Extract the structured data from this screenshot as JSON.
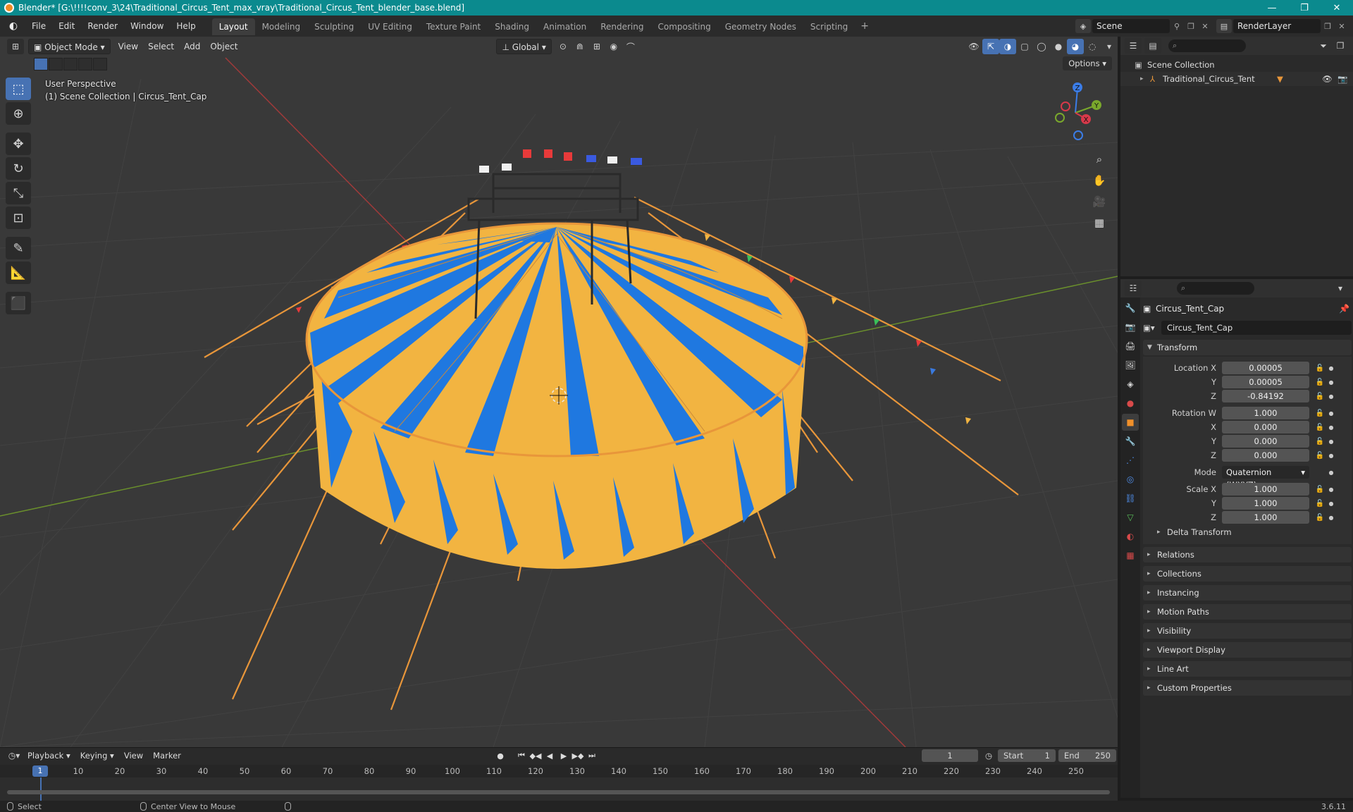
{
  "window": {
    "title": "Blender* [G:\\!!!!conv_3\\24\\Traditional_Circus_Tent_max_vray\\Traditional_Circus_Tent_blender_base.blend]",
    "minimize": "—",
    "maximize": "❐",
    "close": "✕"
  },
  "menu": [
    "File",
    "Edit",
    "Render",
    "Window",
    "Help"
  ],
  "workspaces": [
    "Layout",
    "Modeling",
    "Sculpting",
    "UV Editing",
    "Texture Paint",
    "Shading",
    "Animation",
    "Rendering",
    "Compositing",
    "Geometry Nodes",
    "Scripting"
  ],
  "active_workspace": "Layout",
  "scene": {
    "name": "Scene",
    "view_layer": "RenderLayer"
  },
  "viewport": {
    "mode": "Object Mode",
    "menus": [
      "View",
      "Select",
      "Add",
      "Object"
    ],
    "transform_orientation": "Global",
    "options_label": "Options",
    "perspective_label": "User Perspective",
    "collection_label": "(1) Scene Collection | Circus_Tent_Cap",
    "gizmo_axes": {
      "x": "X",
      "y": "Y",
      "z": "Z"
    },
    "colors": {
      "tent_blue": "#1f78e0",
      "tent_yellow": "#f2b441",
      "rope_orange": "#e8963a",
      "grid": "#474747"
    }
  },
  "outliner": {
    "search_placeholder": "",
    "root": "Scene Collection",
    "items": [
      {
        "name": "Traditional_Circus_Tent"
      }
    ]
  },
  "properties": {
    "object_name": "Circus_Tent_Cap",
    "datablock_name": "Circus_Tent_Cap",
    "transform": {
      "title": "Transform",
      "location_label": "Location X",
      "location": {
        "x": "0.00005",
        "y": "0.00005",
        "z": "-0.84192"
      },
      "rotation_label": "Rotation W",
      "rotation": {
        "w": "1.000",
        "x": "0.000",
        "y": "0.000",
        "z": "0.000"
      },
      "mode_label": "Mode",
      "mode_value": "Quaternion (WXYZ)",
      "scale_label": "Scale X",
      "scale": {
        "x": "1.000",
        "y": "1.000",
        "z": "1.000"
      },
      "axis_y": "Y",
      "axis_z": "Z",
      "axis_x": "X",
      "delta": "Delta Transform"
    },
    "collapsed_panels": [
      "Relations",
      "Collections",
      "Instancing",
      "Motion Paths",
      "Visibility",
      "Viewport Display",
      "Line Art",
      "Custom Properties"
    ]
  },
  "timeline": {
    "menus": [
      "Playback",
      "Keying",
      "View",
      "Marker"
    ],
    "current_frame": "1",
    "start_label": "Start",
    "start": "1",
    "end_label": "End",
    "end": "250",
    "ruler": [
      "10",
      "20",
      "30",
      "40",
      "50",
      "60",
      "70",
      "80",
      "90",
      "100",
      "110",
      "120",
      "130",
      "140",
      "150",
      "160",
      "170",
      "180",
      "190",
      "200",
      "210",
      "220",
      "230",
      "240",
      "250"
    ],
    "playhead": "1"
  },
  "status": {
    "left": "Select",
    "middle": "Center View to Mouse",
    "version": "3.6.11"
  }
}
